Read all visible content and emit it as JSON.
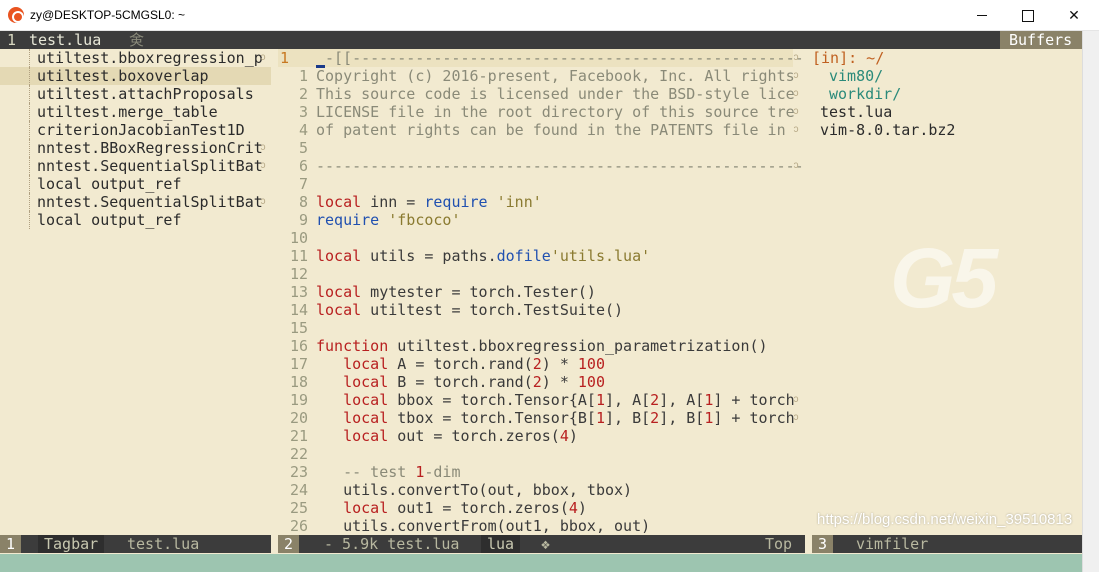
{
  "window": {
    "title": "zy@DESKTOP-5CMGSL0: ~",
    "icon": "ubuntu-icon"
  },
  "tabline": {
    "tab_number": "1",
    "tab_label": "test.lua",
    "tab_glyph": "㑒",
    "buffers_label": "Buffers"
  },
  "tagbar": {
    "items": [
      {
        "text": "utiltest.bboxregression_p",
        "trail": "ↄ",
        "selected": false
      },
      {
        "text": "utiltest.boxoverlap",
        "trail": "",
        "selected": true
      },
      {
        "text": "utiltest.attachProposals",
        "trail": "",
        "selected": false
      },
      {
        "text": "utiltest.merge_table",
        "trail": "",
        "selected": false
      },
      {
        "text": "criterionJacobianTest1D",
        "trail": "",
        "selected": false
      },
      {
        "text": "nntest.BBoxRegressionCrit",
        "trail": "ↄ",
        "selected": false
      },
      {
        "text": "nntest.SequentialSplitBat",
        "trail": "ↄ",
        "selected": false
      },
      {
        "text": "local output_ref",
        "trail": "",
        "selected": false
      },
      {
        "text": "nntest.SequentialSplitBat",
        "trail": "ↄ",
        "selected": false
      },
      {
        "text": "local output_ref",
        "trail": "",
        "selected": false
      }
    ]
  },
  "editor": {
    "lines": [
      {
        "n": "1",
        "text": "--[[---------------------------------------------------------",
        "trail": "ↄ"
      },
      {
        "n": "1",
        "text": "Copyright (c) 2016-present, Facebook, Inc. All rights",
        "trail": "ↄ"
      },
      {
        "n": "2",
        "text": "This source code is licensed under the BSD-style lice",
        "trail": "ↄ"
      },
      {
        "n": "3",
        "text": "LICENSE file in the root directory of this source tre",
        "trail": "ↄ"
      },
      {
        "n": "4",
        "text": "of patent rights can be found in the PATENTS file in",
        "trail": "ↄ"
      },
      {
        "n": "5",
        "text": "",
        "trail": ""
      },
      {
        "n": "6",
        "text": "------------------------------------------------------------",
        "trail": "ↄ"
      },
      {
        "n": "7",
        "text": "",
        "trail": ""
      },
      {
        "n": "8",
        "text": "local inn = require 'inn'",
        "trail": ""
      },
      {
        "n": "9",
        "text": "require 'fbcoco'",
        "trail": ""
      },
      {
        "n": "10",
        "text": "",
        "trail": ""
      },
      {
        "n": "11",
        "text": "local utils = paths.dofile'utils.lua'",
        "trail": ""
      },
      {
        "n": "12",
        "text": "",
        "trail": ""
      },
      {
        "n": "13",
        "text": "local mytester = torch.Tester()",
        "trail": ""
      },
      {
        "n": "14",
        "text": "local utiltest = torch.TestSuite()",
        "trail": ""
      },
      {
        "n": "15",
        "text": "",
        "trail": ""
      },
      {
        "n": "16",
        "text": "function utiltest.bboxregression_parametrization()",
        "trail": ""
      },
      {
        "n": "17",
        "text": "   local A = torch.rand(2) * 100",
        "trail": ""
      },
      {
        "n": "18",
        "text": "   local B = torch.rand(2) * 100",
        "trail": ""
      },
      {
        "n": "19",
        "text": "   local bbox = torch.Tensor{A[1], A[2], A[1] + torch",
        "trail": "ↄ"
      },
      {
        "n": "20",
        "text": "   local tbox = torch.Tensor{B[1], B[2], B[1] + torch",
        "trail": "ↄ"
      },
      {
        "n": "21",
        "text": "   local out = torch.zeros(4)",
        "trail": ""
      },
      {
        "n": "22",
        "text": "",
        "trail": ""
      },
      {
        "n": "23",
        "text": "   -- test 1-dim",
        "trail": ""
      },
      {
        "n": "24",
        "text": "   utils.convertTo(out, bbox, tbox)",
        "trail": ""
      },
      {
        "n": "25",
        "text": "   local out1 = torch.zeros(4)",
        "trail": ""
      },
      {
        "n": "26",
        "text": "   utils.convertFrom(out1, bbox, out)",
        "trail": ""
      }
    ]
  },
  "filer": {
    "header": "[in]: ~/",
    "items": [
      {
        "text": "vim80/",
        "kind": "dir"
      },
      {
        "text": "workdir/",
        "kind": "dir"
      },
      {
        "text": "test.lua",
        "kind": "file"
      },
      {
        "text": "vim-8.0.tar.bz2",
        "kind": "file"
      }
    ]
  },
  "watermark": "G5",
  "status": {
    "left_num": "1",
    "left_name": "Tagbar",
    "left_file": "test.lua",
    "mid_num": "2",
    "mid_info": "- 5.9k test.lua",
    "mid_ft": "lua",
    "mid_icon": "❖",
    "mid_pos": "Top",
    "right_num": "3",
    "right_name": "vimfiler",
    "blog_overlay": "https://blog.csdn.net/weixin_39510813"
  },
  "colors": {
    "background": "#f2ead0",
    "statusbar": "#3c3c3c",
    "keyword": "#b82020",
    "function": "#2050b0",
    "string": "#8a7a30",
    "comment": "#8a8a78",
    "directory": "#2a8a7a"
  }
}
